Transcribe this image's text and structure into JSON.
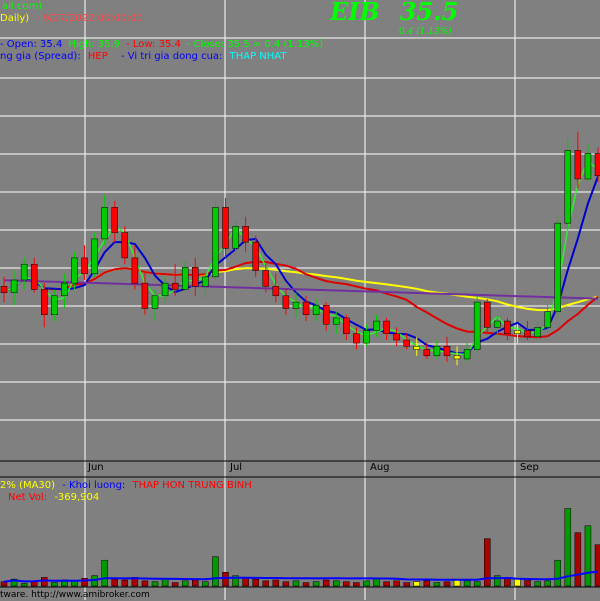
{
  "header": {
    "line1_a": "ail.com)",
    "line1_b": "Daily)",
    "line1_date": "- 9/27/2022 00:00:00",
    "ticker": "EIB",
    "price": "35.5",
    "change": "0.4 (1.13%)",
    "line2_parts": [
      {
        "text": "- Open: 35.4",
        "color": "#0000ff"
      },
      {
        "text": "High: 35.9",
        "color": "#00ff00"
      },
      {
        "text": "- Low: 35.4",
        "color": "#ff0000"
      },
      {
        "text": "- Close: 35.5  =  0.4  (1.13%)",
        "color": "#00ff00"
      }
    ],
    "line3_label1": "ng gia (Spread):",
    "line3_value1": "HEP",
    "line3_label2": "Vi tri gia dong cua:",
    "line3_value2": "THAP NHAT"
  },
  "lower_panel": {
    "line1_a": "2% (MA30)",
    "line1_b": "- Khoi luong:",
    "line1_c": "THAP HON TRUNG BINH",
    "line2_label": "Net Vol:",
    "line2_value": "-369,904"
  },
  "footer": {
    "text": "tware.  http://www.amibroker.com"
  },
  "colors": {
    "background": "#808080",
    "grid": "#ffffff",
    "up": "#00cc00",
    "down": "#ff0000",
    "neutral": "#ffff00",
    "ma_blue": "#0000cc",
    "ma_red": "#dd0000",
    "ma_yellow": "#ffff00",
    "ma_purple": "#7030a0",
    "ma_green": "#33ee33",
    "label_red": "#ff0000",
    "label_cyan": "#00ffff"
  },
  "chart_data": {
    "type": "candlestick",
    "x_labels": [
      "Jun",
      "Jul",
      "Aug",
      "Sep"
    ],
    "price_series": {
      "candles_approx": [
        {
          "o": 32.1,
          "h": 32.4,
          "l": 31.6,
          "c": 31.9
        },
        {
          "o": 31.9,
          "h": 32.6,
          "l": 31.5,
          "c": 32.3
        },
        {
          "o": 32.3,
          "h": 33.0,
          "l": 32.0,
          "c": 32.8
        },
        {
          "o": 32.8,
          "h": 33.0,
          "l": 31.9,
          "c": 32.0
        },
        {
          "o": 32.0,
          "h": 32.2,
          "l": 30.8,
          "c": 31.2
        },
        {
          "o": 31.2,
          "h": 32.0,
          "l": 31.0,
          "c": 31.8
        },
        {
          "o": 31.8,
          "h": 32.5,
          "l": 31.4,
          "c": 32.2
        },
        {
          "o": 32.2,
          "h": 33.2,
          "l": 32.0,
          "c": 33.0
        },
        {
          "o": 33.0,
          "h": 33.4,
          "l": 32.3,
          "c": 32.5
        },
        {
          "o": 32.5,
          "h": 33.8,
          "l": 32.4,
          "c": 33.6
        },
        {
          "o": 33.6,
          "h": 35.0,
          "l": 33.4,
          "c": 34.6
        },
        {
          "o": 34.6,
          "h": 34.8,
          "l": 33.5,
          "c": 33.8
        },
        {
          "o": 33.8,
          "h": 34.0,
          "l": 32.8,
          "c": 33.0
        },
        {
          "o": 33.0,
          "h": 33.4,
          "l": 32.0,
          "c": 32.2
        },
        {
          "o": 32.2,
          "h": 32.6,
          "l": 31.2,
          "c": 31.4
        },
        {
          "o": 31.4,
          "h": 32.0,
          "l": 31.0,
          "c": 31.8
        },
        {
          "o": 31.8,
          "h": 32.4,
          "l": 31.6,
          "c": 32.2
        },
        {
          "o": 32.2,
          "h": 32.8,
          "l": 31.8,
          "c": 32.0
        },
        {
          "o": 32.0,
          "h": 32.9,
          "l": 31.9,
          "c": 32.7
        },
        {
          "o": 32.7,
          "h": 33.0,
          "l": 31.8,
          "c": 32.1
        },
        {
          "o": 32.1,
          "h": 32.6,
          "l": 31.7,
          "c": 32.4
        },
        {
          "o": 32.4,
          "h": 34.8,
          "l": 32.3,
          "c": 34.6
        },
        {
          "o": 34.6,
          "h": 34.9,
          "l": 33.0,
          "c": 33.3
        },
        {
          "o": 33.3,
          "h": 34.2,
          "l": 33.1,
          "c": 34.0
        },
        {
          "o": 34.0,
          "h": 34.3,
          "l": 33.2,
          "c": 33.5
        },
        {
          "o": 33.5,
          "h": 33.7,
          "l": 32.4,
          "c": 32.6
        },
        {
          "o": 32.6,
          "h": 32.8,
          "l": 31.9,
          "c": 32.1
        },
        {
          "o": 32.1,
          "h": 32.5,
          "l": 31.6,
          "c": 31.8
        },
        {
          "o": 31.8,
          "h": 32.0,
          "l": 31.2,
          "c": 31.4
        },
        {
          "o": 31.4,
          "h": 31.9,
          "l": 31.1,
          "c": 31.6
        },
        {
          "o": 31.6,
          "h": 31.8,
          "l": 31.0,
          "c": 31.2
        },
        {
          "o": 31.2,
          "h": 31.7,
          "l": 31.0,
          "c": 31.5
        },
        {
          "o": 31.5,
          "h": 31.6,
          "l": 30.7,
          "c": 30.9
        },
        {
          "o": 30.9,
          "h": 31.3,
          "l": 30.6,
          "c": 31.1
        },
        {
          "o": 31.1,
          "h": 31.2,
          "l": 30.4,
          "c": 30.6
        },
        {
          "o": 30.6,
          "h": 30.8,
          "l": 30.1,
          "c": 30.3
        },
        {
          "o": 30.3,
          "h": 30.9,
          "l": 30.2,
          "c": 30.7
        },
        {
          "o": 30.7,
          "h": 31.2,
          "l": 30.5,
          "c": 31.0
        },
        {
          "o": 31.0,
          "h": 31.1,
          "l": 30.4,
          "c": 30.6
        },
        {
          "o": 30.6,
          "h": 30.8,
          "l": 30.2,
          "c": 30.4
        },
        {
          "o": 30.4,
          "h": 30.6,
          "l": 30.1,
          "c": 30.2
        },
        {
          "o": 30.2,
          "h": 30.5,
          "l": 29.9,
          "c": 30.1
        },
        {
          "o": 30.1,
          "h": 30.3,
          "l": 29.8,
          "c": 29.9
        },
        {
          "o": 29.9,
          "h": 30.4,
          "l": 29.8,
          "c": 30.2
        },
        {
          "o": 30.2,
          "h": 30.5,
          "l": 29.7,
          "c": 29.9
        },
        {
          "o": 29.9,
          "h": 30.2,
          "l": 29.6,
          "c": 29.8
        },
        {
          "o": 29.8,
          "h": 30.3,
          "l": 29.7,
          "c": 30.1
        },
        {
          "o": 30.1,
          "h": 31.8,
          "l": 30.0,
          "c": 31.6
        },
        {
          "o": 31.6,
          "h": 31.7,
          "l": 30.6,
          "c": 30.8
        },
        {
          "o": 30.8,
          "h": 31.2,
          "l": 30.5,
          "c": 31.0
        },
        {
          "o": 31.0,
          "h": 31.1,
          "l": 30.4,
          "c": 30.6
        },
        {
          "o": 30.6,
          "h": 30.9,
          "l": 30.3,
          "c": 30.7
        },
        {
          "o": 30.7,
          "h": 31.0,
          "l": 30.4,
          "c": 30.5
        },
        {
          "o": 30.5,
          "h": 31.0,
          "l": 30.4,
          "c": 30.8
        },
        {
          "o": 30.8,
          "h": 31.5,
          "l": 30.6,
          "c": 31.3
        },
        {
          "o": 31.3,
          "h": 34.3,
          "l": 31.1,
          "c": 34.1
        },
        {
          "o": 34.1,
          "h": 36.8,
          "l": 33.9,
          "c": 36.4
        },
        {
          "o": 36.4,
          "h": 37.0,
          "l": 35.2,
          "c": 35.5
        },
        {
          "o": 35.5,
          "h": 36.6,
          "l": 35.4,
          "c": 36.3
        },
        {
          "o": 36.3,
          "h": 36.5,
          "l": 35.4,
          "c": 35.6
        }
      ]
    },
    "volume_bars_relative": [
      0.05,
      0.08,
      0.03,
      0.06,
      0.1,
      0.04,
      0.07,
      0.06,
      0.09,
      0.12,
      0.3,
      0.08,
      0.07,
      0.1,
      0.06,
      0.05,
      0.08,
      0.04,
      0.06,
      0.07,
      0.05,
      0.34,
      0.16,
      0.12,
      0.1,
      0.08,
      0.06,
      0.07,
      0.05,
      0.06,
      0.04,
      0.05,
      0.07,
      0.06,
      0.05,
      0.04,
      0.06,
      0.08,
      0.05,
      0.06,
      0.04,
      0.05,
      0.06,
      0.04,
      0.05,
      0.07,
      0.06,
      0.05,
      0.55,
      0.12,
      0.1,
      0.08,
      0.07,
      0.05,
      0.06,
      0.3,
      0.9,
      0.62,
      0.7,
      0.48
    ],
    "volume_label": "Net Vol: -369,904"
  }
}
